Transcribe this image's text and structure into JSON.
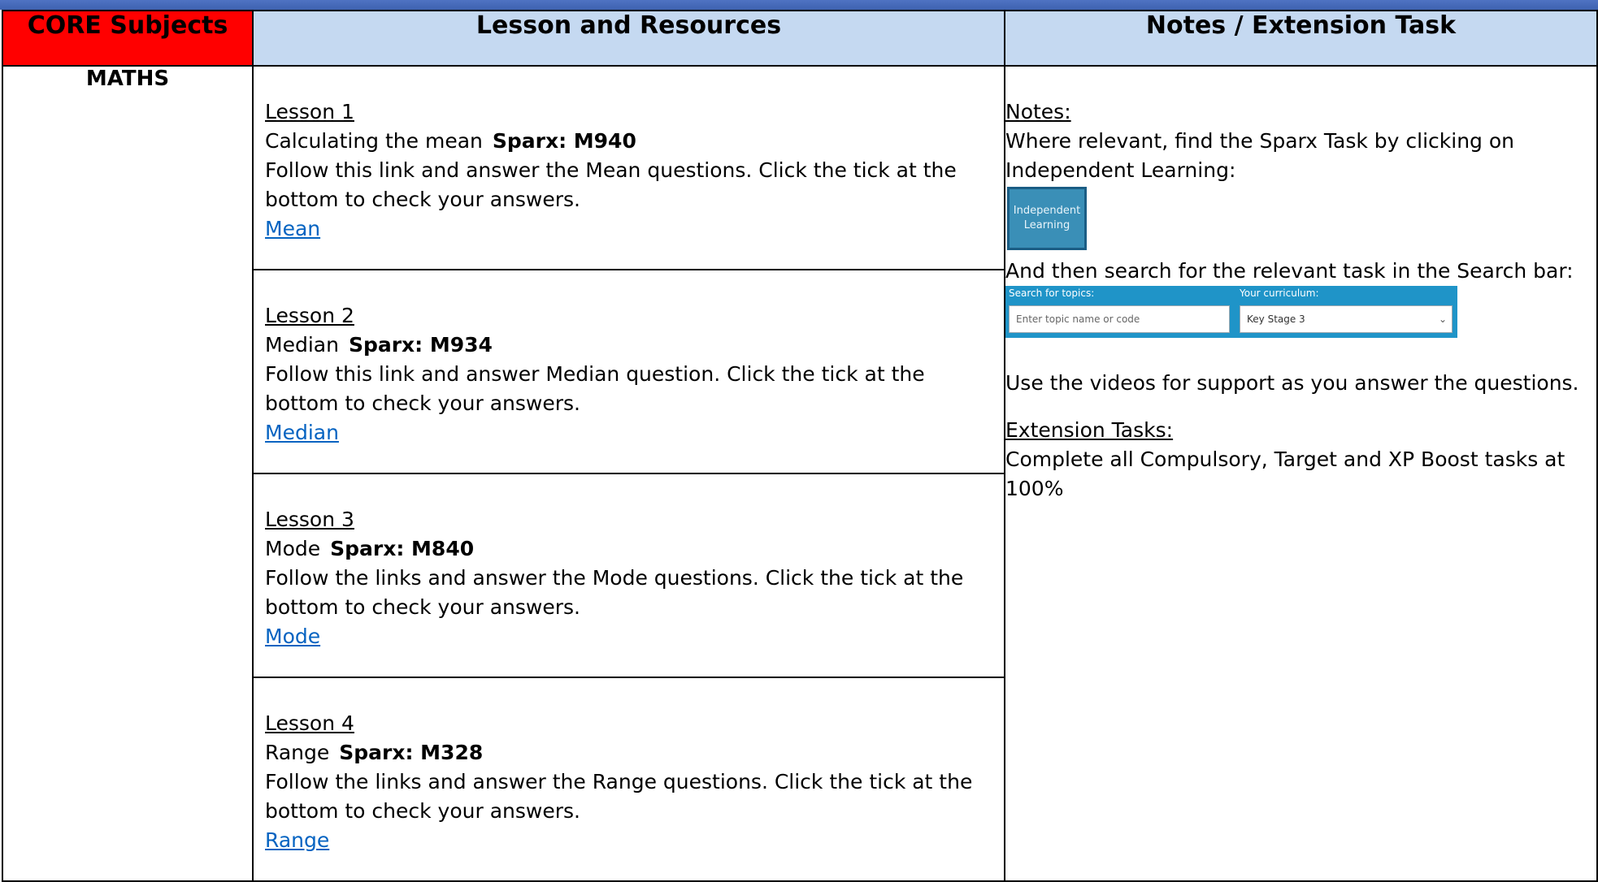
{
  "header": {
    "core_subjects": "CORE Subjects",
    "lesson_resources": "Lesson and Resources",
    "notes_extension": "Notes / Extension Task"
  },
  "subject": "MATHS",
  "lessons": [
    {
      "title": "Lesson 1",
      "topic": "Calculating the mean",
      "code": "Sparx: M940",
      "instructions": "Follow this link and answer the Mean questions. Click the tick at the bottom to check your answers.",
      "link": "Mean"
    },
    {
      "title": "Lesson 2",
      "topic": "Median",
      "code": "Sparx: M934",
      "instructions": "Follow this link and answer Median question. Click the tick at the bottom to check your answers.",
      "link": "Median"
    },
    {
      "title": "Lesson 3",
      "topic": "Mode",
      "code": "Sparx: M840",
      "instructions": "Follow the links and answer the Mode questions. Click the tick at the bottom to check your answers.",
      "link": "Mode"
    },
    {
      "title": "Lesson 4",
      "topic": "Range",
      "code": "Sparx: M328",
      "instructions": "Follow the links and answer the Range questions. Click the tick at the bottom to check your answers.",
      "link": "Range"
    }
  ],
  "notes": {
    "notes_heading": "Notes:",
    "find_task": "Where relevant, find the Sparx Task by clicking on Independent Learning:",
    "il_button": "Independent Learning",
    "search_instruction": "And then search for the relevant task in the Search bar:",
    "search_topics_label": "Search for topics:",
    "search_placeholder": "Enter topic name or code",
    "curriculum_label": "Your curriculum:",
    "curriculum_value": "Key Stage 3",
    "videos": "Use the videos for support as you answer the questions.",
    "extension_heading": "Extension Tasks:",
    "extension_text": "Complete all Compulsory, Target and XP Boost tasks at 100%"
  }
}
